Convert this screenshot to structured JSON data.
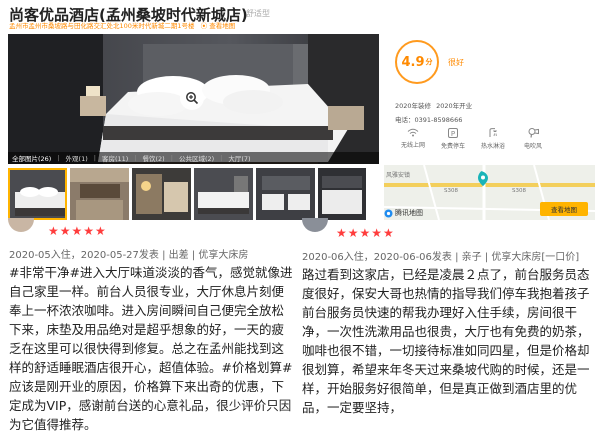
{
  "hotel": {
    "name": "尚客优品酒店(孟州桑坡时代新城店)",
    "tag": "舒适型",
    "address": "孟州市孟州市桑坡路与田化路交汇处北100米时代新城二期1号楼",
    "map_link": "查看地图"
  },
  "photo_tabs": [
    {
      "label": "全部图片(26)"
    },
    {
      "label": "外观(1)"
    },
    {
      "label": "客房(11)"
    },
    {
      "label": "餐饮(2)"
    },
    {
      "label": "公共区域(2)"
    },
    {
      "label": "大厅(7)"
    }
  ],
  "score": {
    "value": "4.9",
    "unit": "分",
    "word": "很好"
  },
  "info": {
    "decorated": "2020年装修",
    "opened": "2020年开业",
    "phone_label": "电话：",
    "phone": "0391-8598666"
  },
  "amenities": [
    {
      "label": "无线上网",
      "icon": "wifi-icon"
    },
    {
      "label": "免费停车",
      "icon": "parking-icon"
    },
    {
      "label": "热水淋浴",
      "icon": "shower-icon"
    },
    {
      "label": "电吹风",
      "icon": "hairdryer-icon"
    }
  ],
  "map": {
    "brand": "腾讯地图",
    "button": "查看地图",
    "label_1": "风雅安镇",
    "label_2": "S308",
    "label_3": "S308"
  },
  "reviews": [
    {
      "meta": "2020-05入住，2020-05-27发表 | 出差 | 优享大床房",
      "text": "#非常干净#进入大厅味道淡淡的香气，感觉就像进自己家里一样。前台人员很专业，大厅休息片刻便奉上一杯浓浓咖啡。进入房间瞬间自己便完全放松下来，床垫及用品绝对是超乎想象的好，一天的疲乏在这里可以很快得到修复。总之在孟州能找到这样的舒适睡眠酒店很开心，超值体验。#价格划算#应该是刚开业的原因，价格算下来出奇的优惠，下定成为VIP，感谢前台送的心意礼品，很少评价只因为它值得推荐。"
    },
    {
      "meta": "2020-06入住，2020-06-06发表 | 亲子 | 优享大床房[一口价]",
      "text": "路过看到这家店，已经是凌晨２点了，前台服务员态度很好，保安大哥也热情的指导我们停车我抱着孩子前台服务员快速的帮我办理好入住手续，房间很干净，一次性洗漱用品也很贵，大厅也有免费的奶茶，咖啡也很不错，一切接待标准如同四星，但是价格却很划算，希望来年冬天过来桑坡代购的时候，还是一样，开始服务好很简单，但是真正做到酒店里的优品，一定要坚持，"
    }
  ]
}
